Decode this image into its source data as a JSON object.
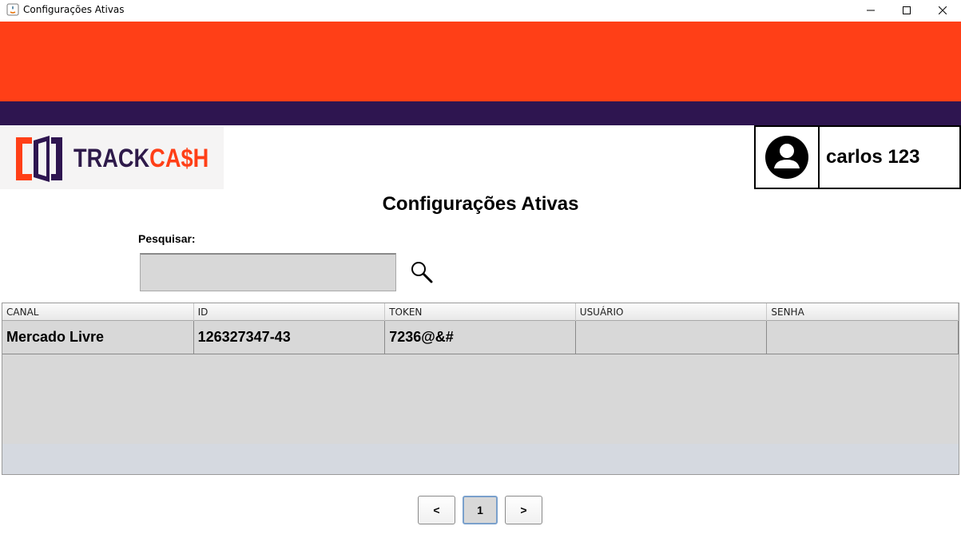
{
  "window": {
    "title": "Configurações Ativas",
    "controls": [
      "minimize-icon",
      "maximize-icon",
      "close-icon"
    ]
  },
  "colors": {
    "banner_orange": "#ff3f17",
    "banner_purple": "#2e1550",
    "table_bg": "#d8d8d8"
  },
  "logo": {
    "track": "TRACK",
    "cash": "CA$H"
  },
  "user": {
    "avatar_icon": "user-circle-icon",
    "name": "carlos 123"
  },
  "page": {
    "title": "Configurações Ativas"
  },
  "search": {
    "label": "Pesquisar:",
    "value": "",
    "icon": "search-icon"
  },
  "table": {
    "columns": [
      "CANAL",
      "ID",
      "TOKEN",
      "USUÁRIO",
      "SENHA"
    ],
    "rows": [
      [
        "Mercado Livre",
        "126327347-43",
        "7236@&#",
        "",
        ""
      ]
    ]
  },
  "pagination": {
    "prev": "<",
    "current": "1",
    "next": ">"
  }
}
